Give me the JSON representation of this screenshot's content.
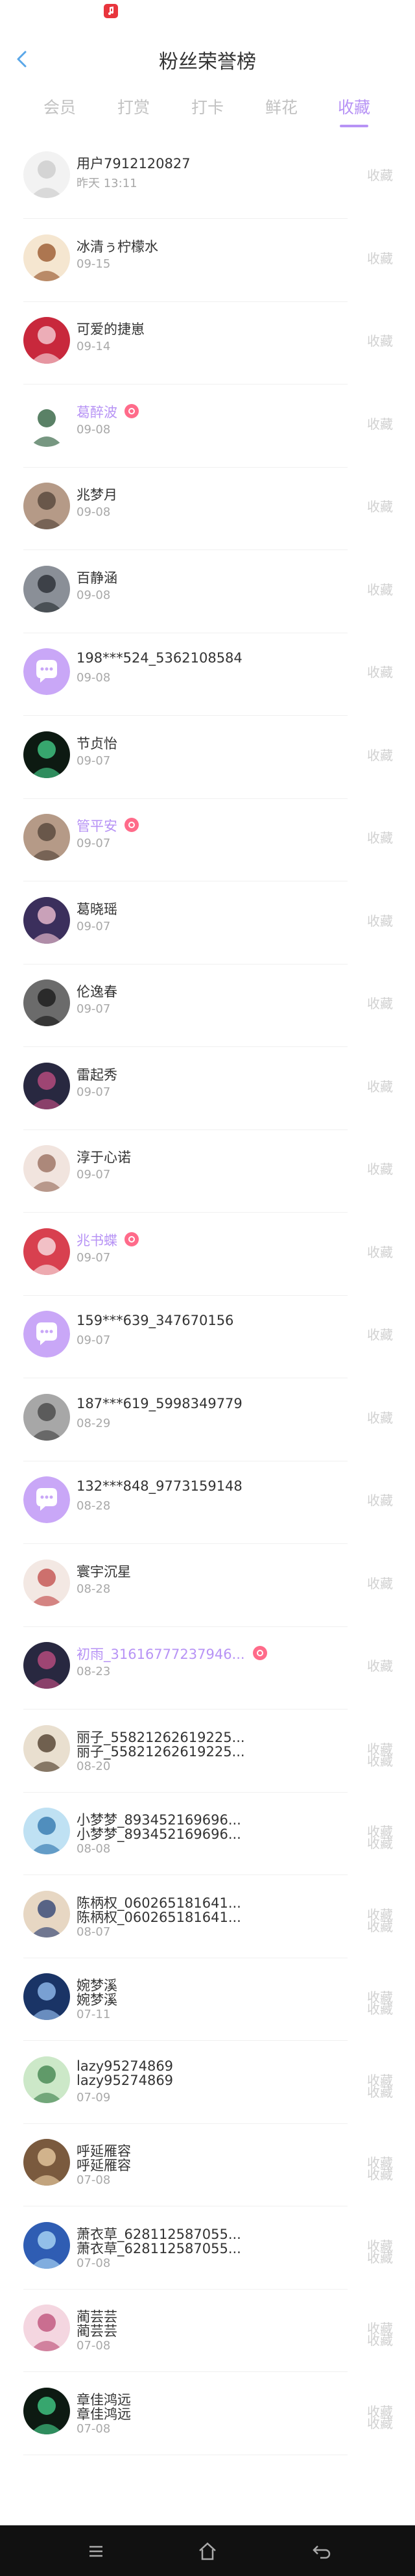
{
  "header": {
    "title": "粉丝荣誉榜"
  },
  "tabs": [
    {
      "label": "会员",
      "active": false
    },
    {
      "label": "打赏",
      "active": false
    },
    {
      "label": "打卡",
      "active": false
    },
    {
      "label": "鲜花",
      "active": false
    },
    {
      "label": "收藏",
      "active": true
    }
  ],
  "action_label": "收藏",
  "colors": {
    "accent": "#b793f5",
    "badge": "#ff6b8a"
  },
  "items": [
    {
      "name": "用户7912120827",
      "date": "昨天 13:11",
      "avatar": "sketch",
      "purple": false,
      "badge": false
    },
    {
      "name": "冰清ぅ柠檬水",
      "date": "09-15",
      "avatar": "anime",
      "purple": false,
      "badge": false
    },
    {
      "name": "可爱的捷崽",
      "date": "09-14",
      "avatar": "red",
      "purple": false,
      "badge": false
    },
    {
      "name": "葛醉波",
      "date": "09-08",
      "avatar": "figure",
      "purple": true,
      "badge": true
    },
    {
      "name": "兆梦月",
      "date": "09-08",
      "avatar": "photo",
      "purple": false,
      "badge": false
    },
    {
      "name": "百静涵",
      "date": "09-08",
      "avatar": "photo2",
      "purple": false,
      "badge": false
    },
    {
      "name": "198***524_5362108584",
      "date": "09-08",
      "avatar": "default",
      "purple": false,
      "badge": false
    },
    {
      "name": "节贞怡",
      "date": "09-07",
      "avatar": "dark",
      "purple": false,
      "badge": false
    },
    {
      "name": "管平安",
      "date": "09-07",
      "avatar": "photo",
      "purple": true,
      "badge": true
    },
    {
      "name": "葛晓瑶",
      "date": "09-07",
      "avatar": "girl",
      "purple": false,
      "badge": false
    },
    {
      "name": "伦逸春",
      "date": "09-07",
      "avatar": "bw",
      "purple": false,
      "badge": false
    },
    {
      "name": "雷起秀",
      "date": "09-07",
      "avatar": "dark2",
      "purple": false,
      "badge": false
    },
    {
      "name": "淳于心诺",
      "date": "09-07",
      "avatar": "light",
      "purple": false,
      "badge": false
    },
    {
      "name": "兆书蝶",
      "date": "09-07",
      "avatar": "red2",
      "purple": true,
      "badge": true
    },
    {
      "name": "159***639_347670156",
      "date": "09-07",
      "avatar": "default",
      "purple": false,
      "badge": false
    },
    {
      "name": "187***619_5998349779",
      "date": "08-29",
      "avatar": "gray",
      "purple": false,
      "badge": false
    },
    {
      "name": "132***848_9773159148",
      "date": "08-28",
      "avatar": "default",
      "purple": false,
      "badge": false
    },
    {
      "name": "寰宇沉星",
      "date": "08-28",
      "avatar": "anime2",
      "purple": false,
      "badge": false
    },
    {
      "name": "初雨_31616777237946...",
      "date": "08-23",
      "avatar": "dark2",
      "purple": true,
      "badge": true
    },
    {
      "name": "丽子_55821262619225...",
      "name2": "丽子_55821262619225...",
      "date": "08-20",
      "avatar": "ink",
      "double": true
    },
    {
      "name": "小梦梦_893452169696...",
      "name2": "小梦梦_893452169696...",
      "date": "08-08",
      "avatar": "blue",
      "double": true
    },
    {
      "name": "陈柄权_060265181641...",
      "name2": "陈柄权_060265181641...",
      "date": "08-07",
      "avatar": "figure2",
      "double": true
    },
    {
      "name": "婉梦溪",
      "name2": "婉梦溪",
      "date": "07-11",
      "avatar": "blue2",
      "double": true
    },
    {
      "name": "lazy95274869",
      "name2": "lazy95274869",
      "date": "07-09",
      "avatar": "green",
      "double": true
    },
    {
      "name": "呼延雁容",
      "name2": "呼延雁容",
      "date": "07-08",
      "avatar": "brown",
      "double": true
    },
    {
      "name": "萧衣草_628112587055...",
      "name2": "萧衣草_628112587055...",
      "date": "07-08",
      "avatar": "blue3",
      "double": true
    },
    {
      "name": "蔺芸芸",
      "name2": "蔺芸芸",
      "date": "07-08",
      "avatar": "pink",
      "double": true
    },
    {
      "name": "章佳鸿远",
      "name2": "章佳鸿远",
      "date": "07-08",
      "avatar": "dark",
      "double": true
    }
  ]
}
